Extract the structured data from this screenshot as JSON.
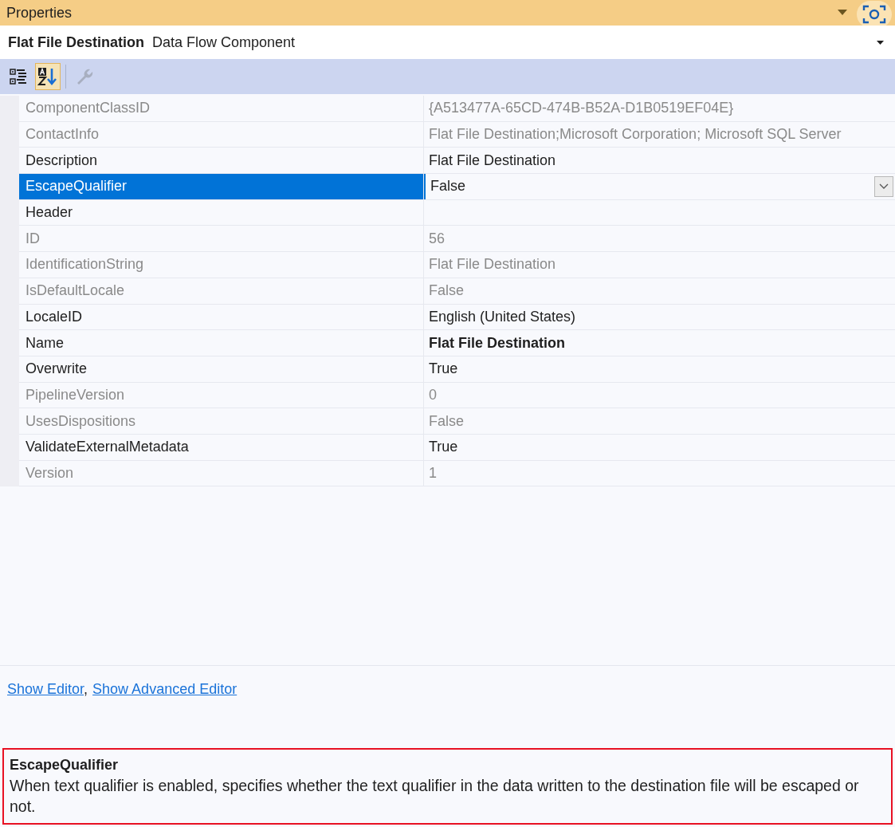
{
  "window": {
    "title": "Properties"
  },
  "object_selector": {
    "name": "Flat File Destination",
    "type": "Data Flow Component"
  },
  "toolbar": [
    {
      "kind": "categorized",
      "selected": false,
      "disabled": false
    },
    {
      "kind": "alphabetical",
      "selected": true,
      "disabled": false
    },
    {
      "kind": "property-pages",
      "selected": false,
      "disabled": true
    }
  ],
  "properties": [
    {
      "name": "ComponentClassID",
      "value": "{A513477A-65CD-474B-B52A-D1B0519EF04E}",
      "readonly": true,
      "selected": false,
      "bold": false
    },
    {
      "name": "ContactInfo",
      "value": "Flat File Destination;Microsoft Corporation; Microsoft SQL Server",
      "readonly": true,
      "selected": false,
      "bold": false
    },
    {
      "name": "Description",
      "value": "Flat File Destination",
      "readonly": false,
      "selected": false,
      "bold": false
    },
    {
      "name": "EscapeQualifier",
      "value": "False",
      "readonly": false,
      "selected": true,
      "bold": false
    },
    {
      "name": "Header",
      "readonly": false,
      "selected": false
    },
    {
      "name": "ID",
      "value": "56",
      "readonly": true,
      "selected": false,
      "bold": false
    },
    {
      "name": "IdentificationString",
      "value": "Flat File Destination",
      "readonly": true,
      "selected": false,
      "bold": false
    },
    {
      "name": "IsDefaultLocale",
      "value": "False",
      "readonly": true,
      "selected": false,
      "bold": false
    },
    {
      "name": "LocaleID",
      "value": "English (United States)",
      "readonly": false,
      "selected": false,
      "bold": false
    },
    {
      "name": "Name",
      "value": "Flat File Destination",
      "readonly": false,
      "selected": false,
      "bold": true
    },
    {
      "name": "Overwrite",
      "value": "True",
      "readonly": false,
      "selected": false,
      "bold": false
    },
    {
      "name": "PipelineVersion",
      "value": "0",
      "readonly": true,
      "selected": false,
      "bold": false
    },
    {
      "name": "UsesDispositions",
      "value": "False",
      "readonly": true,
      "selected": false,
      "bold": false
    },
    {
      "name": "ValidateExternalMetadata",
      "value": "True",
      "readonly": false,
      "selected": false,
      "bold": false
    },
    {
      "name": "Version",
      "value": "1",
      "readonly": true,
      "selected": false,
      "bold": false
    }
  ],
  "commands": [
    {
      "label": "Show Editor",
      "separator": ","
    },
    {
      "label": "Show Advanced Editor"
    }
  ],
  "description": {
    "title": "EscapeQualifier",
    "text": "When text qualifier is enabled, specifies whether the text qualifier in the data written to the destination file will be escaped or not."
  }
}
